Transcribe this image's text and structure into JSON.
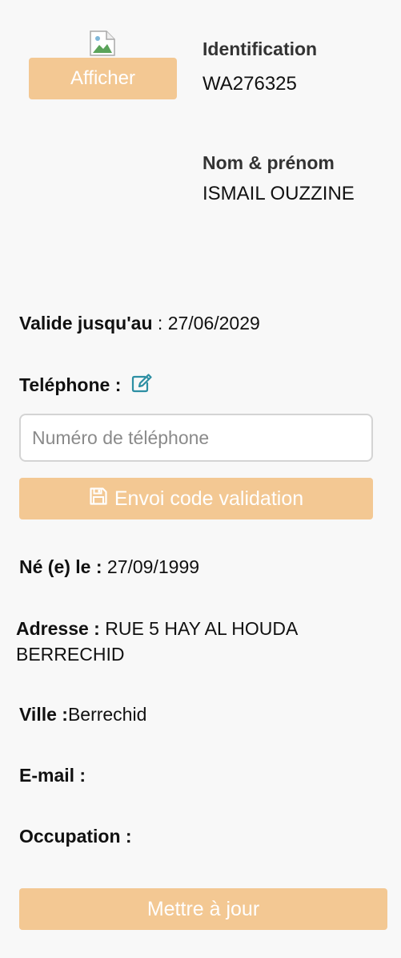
{
  "photo": {
    "button_label": "Afficher"
  },
  "identification": {
    "label": "Identification",
    "value": "WA276325"
  },
  "name": {
    "label": "Nom & prénom",
    "value": "ISMAIL OUZZINE"
  },
  "validity": {
    "label": "Valide jusqu'au",
    "separator": " : ",
    "value": "27/06/2029"
  },
  "phone": {
    "label": "Teléphone :",
    "edit_icon": "edit-icon",
    "input_placeholder": "Numéro de téléphone",
    "input_value": "",
    "send_button_label": "Envoi code validation",
    "send_button_icon": "save-icon"
  },
  "birth": {
    "label": "Né (e) le :",
    "value": " 27/09/1999"
  },
  "address": {
    "label": "Adresse :",
    "value": " RUE 5 HAY AL HOUDA BERRECHID"
  },
  "city": {
    "label": "Ville :",
    "value": "Berrechid"
  },
  "email": {
    "label": "E-mail :",
    "value": ""
  },
  "occupation": {
    "label": "Occupation :",
    "value": ""
  },
  "actions": {
    "update_label": "Mettre à jour"
  },
  "colors": {
    "button_bg": "#f3c893",
    "button_text": "#ffffff",
    "edit_icon": "#2d8fa3",
    "page_bg": "#f8f8f8"
  }
}
